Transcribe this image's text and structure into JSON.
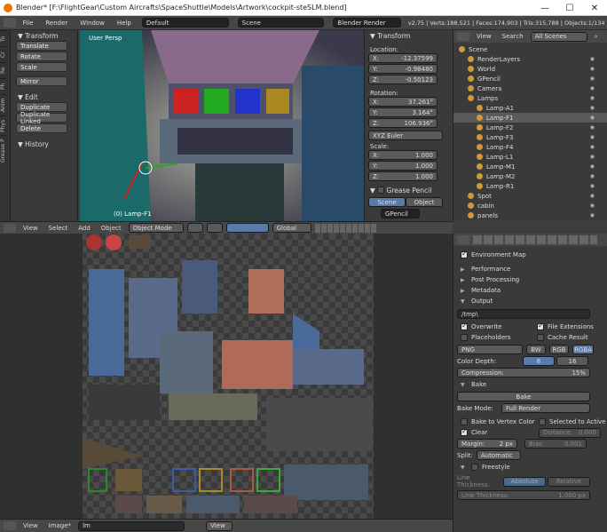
{
  "window": {
    "title": "Blender* [F:\\FlightGear\\Custom Aircrafts\\SpaceShuttle\\Models\\Artwork\\cockpit-steSLM.blend]"
  },
  "menubar": {
    "items": [
      "File",
      "Render",
      "Window",
      "Help"
    ],
    "layout": "Default",
    "scene": "Scene",
    "engine": "Blender Render",
    "stats": "v2.75 | Verts:188,521 | Faces:174,903 | Tris:315,788 | Objects:1/134 | Lamps:1/"
  },
  "toolshelf": {
    "tabs": [
      "To",
      "Cr",
      "Re",
      "Ph",
      "Anim",
      "Phys",
      "Grease P"
    ],
    "transform_header": "Transform",
    "buttons": [
      "Translate",
      "Rotate",
      "Scale"
    ],
    "mirror": "Mirror",
    "edit_header": "Edit",
    "edit_buttons": [
      "Duplicate",
      "Duplicate Linked",
      "Delete"
    ],
    "history_header": "History"
  },
  "viewport": {
    "label": "User Persp",
    "object": "(0) Lamp-F1"
  },
  "viewport_header": {
    "items": [
      "View",
      "Select",
      "Add",
      "Object"
    ],
    "mode": "Object Mode",
    "orientation": "Global"
  },
  "npanel": {
    "header": "Transform",
    "location_label": "Location:",
    "location": [
      {
        "axis": "X:",
        "value": "-12.37599"
      },
      {
        "axis": "Y:",
        "value": "-0.98480"
      },
      {
        "axis": "Z:",
        "value": "-0.50123"
      }
    ],
    "rotation_label": "Rotation:",
    "rotation": [
      {
        "axis": "X:",
        "value": "37.261°"
      },
      {
        "axis": "Y:",
        "value": "3.164°"
      },
      {
        "axis": "Z:",
        "value": "106.936°"
      }
    ],
    "rotation_mode": "XYZ Euler",
    "scale_label": "Scale:",
    "scale": [
      {
        "axis": "X:",
        "value": "1.000"
      },
      {
        "axis": "Y:",
        "value": "1.000"
      },
      {
        "axis": "Z:",
        "value": "1.000"
      }
    ],
    "grease_header": "Grease Pencil",
    "tabs": [
      "Scene",
      "Object"
    ],
    "gpencil": "GPencil"
  },
  "outliner": {
    "header": [
      "View",
      "Search"
    ],
    "filter": "All Scenes",
    "rows": [
      {
        "name": "Scene",
        "indent": 0
      },
      {
        "name": "RenderLayers",
        "indent": 1
      },
      {
        "name": "World",
        "indent": 1
      },
      {
        "name": "GPencil",
        "indent": 1
      },
      {
        "name": "Camera",
        "indent": 1
      },
      {
        "name": "Lamps",
        "indent": 1
      },
      {
        "name": "Lamp-A1",
        "indent": 2
      },
      {
        "name": "Lamp-F1",
        "indent": 2
      },
      {
        "name": "Lamp-F2",
        "indent": 2
      },
      {
        "name": "Lamp-F3",
        "indent": 2
      },
      {
        "name": "Lamp-F4",
        "indent": 2
      },
      {
        "name": "Lamp-L1",
        "indent": 2
      },
      {
        "name": "Lamp-M1",
        "indent": 2
      },
      {
        "name": "Lamp-M2",
        "indent": 2
      },
      {
        "name": "Lamp-R1",
        "indent": 2
      },
      {
        "name": "Spot",
        "indent": 1
      },
      {
        "name": "cabin",
        "indent": 1
      },
      {
        "name": "panels",
        "indent": 1
      }
    ]
  },
  "image_header": {
    "items": [
      "View",
      "Image*"
    ],
    "image": "lm",
    "view": "View"
  },
  "props": {
    "env_map": "Environment Map",
    "collapsed": [
      "Performance",
      "Post Processing",
      "Metadata"
    ],
    "output_header": "Output",
    "output_path": "/tmp\\",
    "overwrite": "Overwrite",
    "file_ext": "File Extensions",
    "placeholders": "Placeholders",
    "cache": "Cache Result",
    "format": "PNG",
    "channels": [
      "BW",
      "RGB",
      "RGBA"
    ],
    "color_depth_label": "Color Depth:",
    "depths": [
      "8",
      "16"
    ],
    "compression_label": "Compression:",
    "compression": "15%",
    "bake_header": "Bake",
    "bake_button": "Bake",
    "bake_mode_label": "Bake Mode:",
    "bake_mode": "Full Render",
    "bake_vertex": "Bake to Vertex Color",
    "sel_active": "Selected to Active",
    "clear": "Clear",
    "distance_label": "Distance:",
    "distance": "0.000",
    "margin_label": "Margin:",
    "margin": "2 px",
    "bias_label": "Bias:",
    "bias": "0.001",
    "split_label": "Split:",
    "split": "Automatic",
    "freestyle": "Freestyle",
    "line_thickness_label": "Line Thickness:",
    "line_modes": [
      "Absolute",
      "Relative"
    ],
    "line_thickness_field": "Line Thickness:",
    "line_thickness": "1.000 px"
  }
}
